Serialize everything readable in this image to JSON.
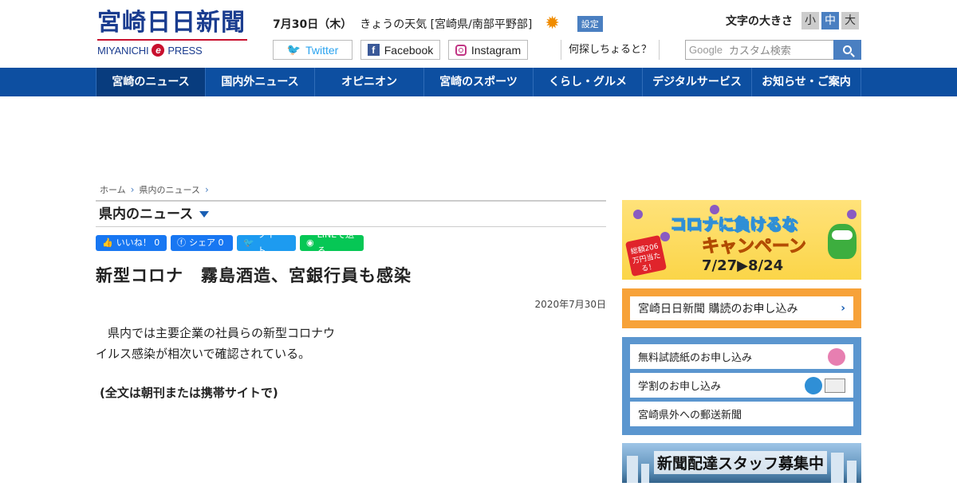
{
  "brand": {
    "name_jp": "宮崎日日新聞",
    "name_en_left": "MIYANICHI",
    "name_en_e": "e",
    "name_en_right": "PRESS"
  },
  "header": {
    "date": "7月30日（木）",
    "weather_label": "きょうの天気 [宮崎県/南部平野部]",
    "weather_icon": "sun-icon",
    "settings_label": "設定",
    "search_prompt": "何探しちょると？",
    "search_google": "Google",
    "search_placeholder": "カスタム検索",
    "font_size_label": "文字の大きさ",
    "font_sizes": [
      "小",
      "中",
      "大"
    ],
    "font_size_selected": "中"
  },
  "social": {
    "twitter": "Twitter",
    "facebook": "Facebook",
    "instagram": "Instagram"
  },
  "nav": {
    "items": [
      "宮崎のニュース",
      "国内外ニュース",
      "オピニオン",
      "宮崎のスポーツ",
      "くらし・グルメ",
      "デジタルサービス",
      "お知らせ・ご案内"
    ],
    "active": "宮崎のニュース"
  },
  "breadcrumb": [
    "ホーム",
    "県内のニュース"
  ],
  "section": {
    "title": "県内のニュース"
  },
  "share": {
    "like": "いいね！ 0",
    "fb_share": "シェア 0",
    "tweet": "ツイート",
    "line": "LINEで送る"
  },
  "article": {
    "headline": "新型コロナ　霧島酒造、宮銀行員も感染",
    "date": "2020年7月30日",
    "body_line1": "　県内では主要企業の社員らの新型コロナウ",
    "body_line2": "イルス感染が相次いで確認されている。",
    "note": "(全文は朝刊または携帯サイトで)"
  },
  "sidebar": {
    "campaign": {
      "title": "コロナに負けるな",
      "subtitle": "キャンペーン",
      "dates": "7/27▶8/24",
      "badge": "総額206万円当たる！"
    },
    "subscribe": "宮崎日日新聞 購読のお申し込み",
    "links": [
      "無料試読紙のお申し込み",
      "学割のお申し込み",
      "宮崎県外への郵送新聞"
    ],
    "recruit": "新聞配達スタッフ募集中"
  },
  "colors": {
    "brand_blue": "#1a3c8f",
    "nav_blue": "#0d4fa1",
    "accent_red": "#c8102e",
    "orange": "#f7a239",
    "sidebar_blue": "#5b96cf"
  }
}
